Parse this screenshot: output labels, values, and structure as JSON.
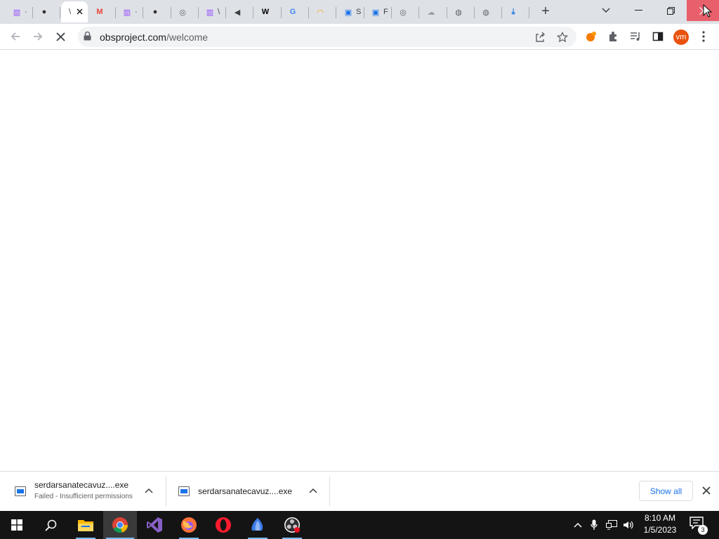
{
  "browser": {
    "tabs": [
      {
        "icon": "twitch-icon",
        "stub": "·",
        "color": "#9146ff"
      },
      {
        "icon": "obs-icon",
        "stub": "",
        "color": "#302e31"
      },
      {
        "icon": "blank-icon",
        "stub": "\\",
        "color": "#3c4043",
        "active": true
      },
      {
        "icon": "gmail-icon",
        "stub": "",
        "color": "#ea4335"
      },
      {
        "icon": "twitch-icon",
        "stub": "·",
        "color": "#9146ff"
      },
      {
        "icon": "obs-icon",
        "stub": "",
        "color": "#302e31"
      },
      {
        "icon": "chrome-icon",
        "stub": "",
        "color": "#5f6368"
      },
      {
        "icon": "twitch-icon",
        "stub": "\\",
        "color": "#9146ff"
      },
      {
        "icon": "speaker-icon",
        "stub": "",
        "color": "#3c4043"
      },
      {
        "icon": "wikipedia-icon",
        "stub": "",
        "color": "#000000"
      },
      {
        "icon": "google-icon",
        "stub": "",
        "color": "#4285f4"
      },
      {
        "icon": "rainbow-icon",
        "stub": "",
        "color": "#f4a300"
      },
      {
        "icon": "monitor-icon",
        "stub": "S",
        "color": "#1a73e8"
      },
      {
        "icon": "monitor-icon",
        "stub": "F",
        "color": "#1a73e8"
      },
      {
        "icon": "chrome-icon",
        "stub": "",
        "color": "#5f6368"
      },
      {
        "icon": "cloud-icon",
        "stub": "",
        "color": "#9aa0a6"
      },
      {
        "icon": "globe-icon",
        "stub": "",
        "color": "#5f6368"
      },
      {
        "icon": "globe-icon",
        "stub": "",
        "color": "#5f6368"
      },
      {
        "icon": "download-icon",
        "stub": "",
        "color": "#1a73e8"
      }
    ],
    "new_tab_label": "+",
    "url_host": "obsproject.com",
    "url_path": "/welcome",
    "profile_initials": "vm",
    "colors": {
      "accent": "#1a73e8",
      "tabstrip": "#dee1e6",
      "close_hover": "#e8606b",
      "avatar": "#e8530e"
    }
  },
  "downloads": {
    "items": [
      {
        "filename": "serdarsanatecavuz....exe",
        "status": "Failed - Insufficient permissions"
      },
      {
        "filename": "serdarsanatecavuz....exe",
        "status": ""
      }
    ],
    "show_all_label": "Show all"
  },
  "taskbar": {
    "apps": [
      "start-icon",
      "search-icon",
      "file-explorer-icon",
      "chrome-icon",
      "visual-studio-icon",
      "firefox-icon",
      "opera-icon",
      "app-icon",
      "obs-icon"
    ],
    "time": "8:10 AM",
    "date": "1/5/2023",
    "notification_count": "3"
  }
}
